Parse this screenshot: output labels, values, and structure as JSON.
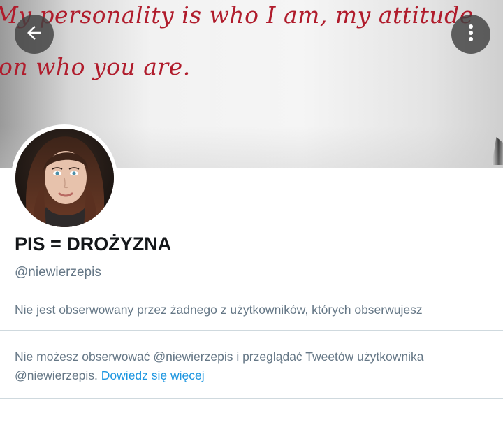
{
  "banner": {
    "line1": "My personality is who I am, my attitude",
    "line2": "on who you are."
  },
  "header": {
    "back_icon": "arrow-left-icon",
    "more_icon": "vertical-dots-icon"
  },
  "profile": {
    "name": "PIS = DROŻYZNA",
    "handle": "@niewierzepis",
    "followed_by_info": "Nie jest obserwowany przez żadnego z użytkowników, których obserwujesz"
  },
  "protected_notice": {
    "text": "Nie możesz obserwować @niewierzepis i przeglądać Tweetów użytkownika @niewierzepis.",
    "link_label": "Dowiedz się więcej"
  },
  "colors": {
    "banner_text": "#b01c2c",
    "secondary_text": "#657786",
    "link": "#1b95e0",
    "divider": "#cfd9de"
  }
}
